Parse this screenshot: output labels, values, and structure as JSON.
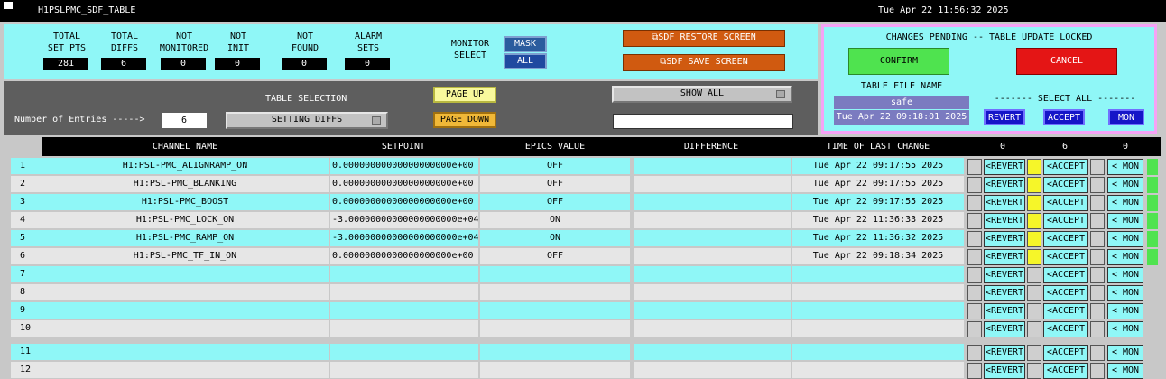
{
  "window": {
    "title": "H1PSLPMC_SDF_TABLE",
    "datetime": "Tue Apr 22 11:56:32 2025"
  },
  "stats": [
    {
      "label": "TOTAL\nSET PTS",
      "value": "281"
    },
    {
      "label": "TOTAL\nDIFFS",
      "value": "6"
    },
    {
      "label": "NOT\nMONITORED",
      "value": "0"
    },
    {
      "label": "NOT\nINIT",
      "value": "0"
    },
    {
      "label": "NOT\nFOUND",
      "value": "0"
    },
    {
      "label": "ALARM\nSETS",
      "value": "0"
    }
  ],
  "monitor": {
    "label": "MONITOR\nSELECT",
    "mask": "MASK",
    "all": "ALL"
  },
  "screens": {
    "restore": "SDF RESTORE SCREEN",
    "save": "SDF SAVE SCREEN"
  },
  "pending": {
    "title": "CHANGES PENDING -- TABLE UPDATE LOCKED",
    "confirm": "CONFIRM",
    "cancel": "CANCEL",
    "table_file_label": "TABLE FILE NAME",
    "table_file": "safe",
    "table_file_time": "Tue Apr 22 09:18:01 2025",
    "select_all": "------- SELECT ALL -------",
    "revert": "REVERT",
    "accept": "ACCEPT",
    "mon": "MON"
  },
  "selection": {
    "title": "TABLE SELECTION",
    "num_entries_label": "Number of Entries ----->",
    "num_entries": "6",
    "table_choice": "SETTING DIFFS",
    "page_up": "PAGE UP",
    "page_down": "PAGE DOWN",
    "show_choice": "SHOW ALL",
    "filter": ""
  },
  "columns": {
    "channel": "CHANNEL NAME",
    "setpoint": "SETPOINT",
    "epics": "EPICS VALUE",
    "difference": "DIFFERENCE",
    "time": "TIME OF LAST CHANGE",
    "count_revert": "0",
    "count_accept": "6",
    "count_mon": "0"
  },
  "action_labels": {
    "revert": "<REVERT",
    "accept": "<ACCEPT",
    "mon": "< MON"
  },
  "rows": [
    {
      "n": "1",
      "channel": "H1:PSL-PMC_ALIGNRAMP_ON",
      "setpoint": "0.00000000000000000000e+00",
      "epics": "OFF",
      "diff": "",
      "time": "Tue Apr 22 09:17:55 2025"
    },
    {
      "n": "2",
      "channel": "H1:PSL-PMC_BLANKING",
      "setpoint": "0.00000000000000000000e+00",
      "epics": "OFF",
      "diff": "",
      "time": "Tue Apr 22 09:17:55 2025"
    },
    {
      "n": "3",
      "channel": "H1:PSL-PMC_BOOST",
      "setpoint": "0.00000000000000000000e+00",
      "epics": "OFF",
      "diff": "",
      "time": "Tue Apr 22 09:17:55 2025"
    },
    {
      "n": "4",
      "channel": "H1:PSL-PMC_LOCK_ON",
      "setpoint": "-3.00000000000000000000e+04",
      "epics": "ON",
      "diff": "",
      "time": "Tue Apr 22 11:36:33 2025"
    },
    {
      "n": "5",
      "channel": "H1:PSL-PMC_RAMP_ON",
      "setpoint": "-3.00000000000000000000e+04",
      "epics": "ON",
      "diff": "",
      "time": "Tue Apr 22 11:36:32 2025"
    },
    {
      "n": "6",
      "channel": "H1:PSL-PMC_TF_IN_ON",
      "setpoint": "0.00000000000000000000e+00",
      "epics": "OFF",
      "diff": "",
      "time": "Tue Apr 22 09:18:34 2025"
    },
    {
      "n": "7",
      "channel": "",
      "setpoint": "",
      "epics": "",
      "diff": "",
      "time": ""
    },
    {
      "n": "8",
      "channel": "",
      "setpoint": "",
      "epics": "",
      "diff": "",
      "time": ""
    },
    {
      "n": "9",
      "channel": "",
      "setpoint": "",
      "epics": "",
      "diff": "",
      "time": ""
    },
    {
      "n": "10",
      "channel": "",
      "setpoint": "",
      "epics": "",
      "diff": "",
      "time": ""
    },
    {
      "n": "11",
      "channel": "",
      "setpoint": "",
      "epics": "",
      "diff": "",
      "time": ""
    },
    {
      "n": "12",
      "channel": "",
      "setpoint": "",
      "epics": "",
      "diff": "",
      "time": ""
    }
  ]
}
